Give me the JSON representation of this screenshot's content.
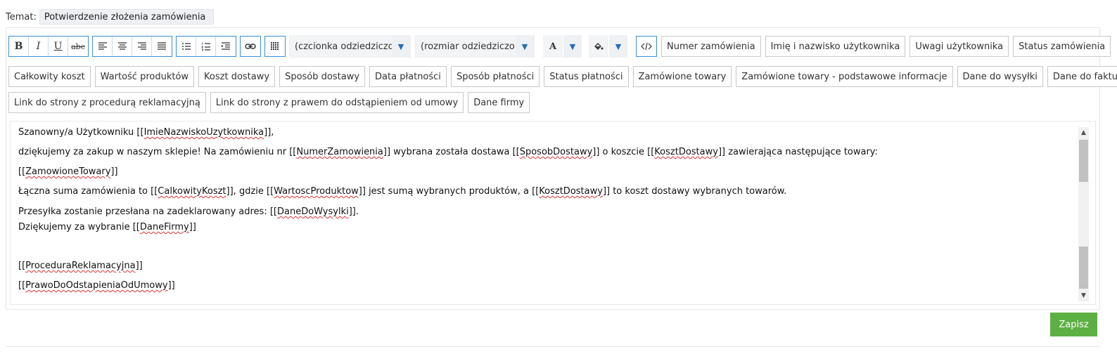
{
  "subject": {
    "label": "Temat:",
    "value": "Potwierdzenie złożenia zamówienia"
  },
  "toolbar": {
    "font_family": "(czcionka odziedziczona)",
    "font_size": "(rozmiar odziedziczony)",
    "bold": "B",
    "italic": "I",
    "underline": "U",
    "strike": "abc",
    "text_color_glyph": "A",
    "caret": "▼"
  },
  "placeholders": [
    "Numer zamówienia",
    "Imię i nazwisko użytkownika",
    "Uwagi użytkownika",
    "Status zamówienia",
    "Całkowity koszt",
    "Wartość produktów",
    "Koszt dostawy",
    "Sposób dostawy",
    "Data płatności",
    "Sposób płatności",
    "Status płatności",
    "Zamówione towary",
    "Zamówione towary - podstawowe informacje",
    "Dane do wysyłki",
    "Dane do faktury",
    "Link do strony z procedurą reklamacyjną",
    "Link do strony z prawem do odstąpieniem od umowy",
    "Dane firmy"
  ],
  "content": {
    "l1a": "Szanowny/a Użytkowniku [[",
    "l1b": "ImieNazwiskoUzytkownika",
    "l1c": "]],",
    "l2a": "dziękujemy za zakup w naszym sklepie! Na zamówieniu nr [[",
    "l2b": "NumerZamowienia",
    "l2c": "]] wybrana została dostawa [[",
    "l2d": "SposobDostawy",
    "l2e": "]] o koszcie [[",
    "l2f": "KosztDostawy",
    "l2g": "]] zawierająca następujące towary:",
    "l3a": "[[",
    "l3b": "ZamowioneTowary",
    "l3c": "]]",
    "l4a": "Łączna suma zamówienia to [[",
    "l4b": "CalkowityKoszt",
    "l4c": "]], gdzie [[",
    "l4d": "WartoscProduktow",
    "l4e": "]] jest sumą wybranych produktów, a [[",
    "l4f": "KosztDostawy",
    "l4g": "]] to koszt dostawy wybranych towarów.",
    "l5a": "Przesyłka zostanie przesłana na zadeklarowany adres: [[",
    "l5b": "DaneDoWysylki",
    "l5c": "]].",
    "l6a": "Dziękujemy za wybranie [[",
    "l6b": "DaneFirmy",
    "l6c": "]]",
    "l7a": "[[",
    "l7b": "ProceduraReklamacyjna",
    "l7c": "]]",
    "l8a": "[[",
    "l8b": "PrawoDoOdstapieniaOdUmowy",
    "l8c": "]]"
  },
  "save_label": "Zapisz",
  "colors": {
    "accent_blue": "#3a8fd8",
    "save_green": "#5cb043",
    "caret_blue": "#1e6fc0"
  }
}
